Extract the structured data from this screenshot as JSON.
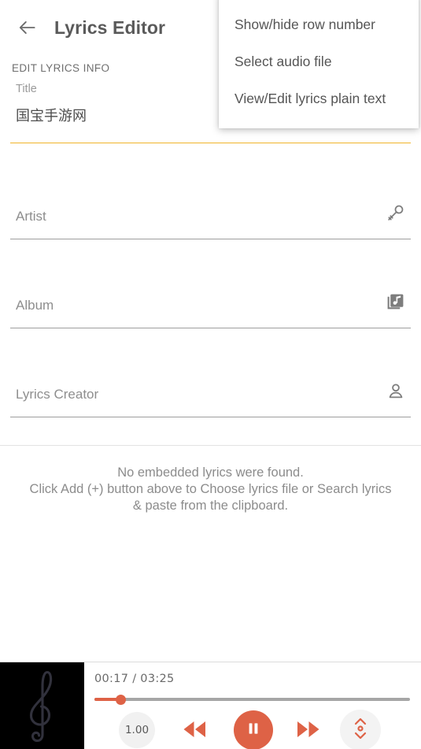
{
  "appbar": {
    "back_icon": "arrow-left-icon",
    "title": "Lyrics Editor"
  },
  "form": {
    "section_header": "EDIT LYRICS INFO",
    "fields": [
      {
        "label": "Title",
        "value": "国宝手游网",
        "focused": true,
        "accent_color": "#f0b429",
        "icon": ""
      },
      {
        "label": "Artist",
        "value": "",
        "placeholder": "Artist",
        "focused": false,
        "icon": "microphone-icon"
      },
      {
        "label": "Album",
        "value": "",
        "placeholder": "Album",
        "focused": false,
        "icon": "album-music-icon"
      },
      {
        "label": "Lyrics Creator",
        "value": "",
        "placeholder": "Lyrics Creator",
        "focused": false,
        "icon": "person-icon"
      }
    ]
  },
  "empty_state": {
    "line1": "No embedded lyrics were found.",
    "line2": "Click Add (+) button above to Choose lyrics file or Search lyrics",
    "line3": "& paste from the clipboard."
  },
  "menu": {
    "items": [
      {
        "label": "Show/hide row number"
      },
      {
        "label": "Select audio file"
      },
      {
        "label": "View/Edit lyrics plain text"
      }
    ]
  },
  "player": {
    "album_art_icon": "treble-clef-icon",
    "current_time": "00:17",
    "separator": "/",
    "total_time": "03:25",
    "time_display": "00:17 / 03:25",
    "progress_percent": 8.3,
    "accent_color": "#de6246",
    "controls": {
      "speed_label": "1.00",
      "rewind_icon": "rewind-icon",
      "play_pause_icon": "pause-icon",
      "fast_forward_icon": "fast-forward-icon",
      "sync_icon": "scroll-updown-icon"
    }
  }
}
